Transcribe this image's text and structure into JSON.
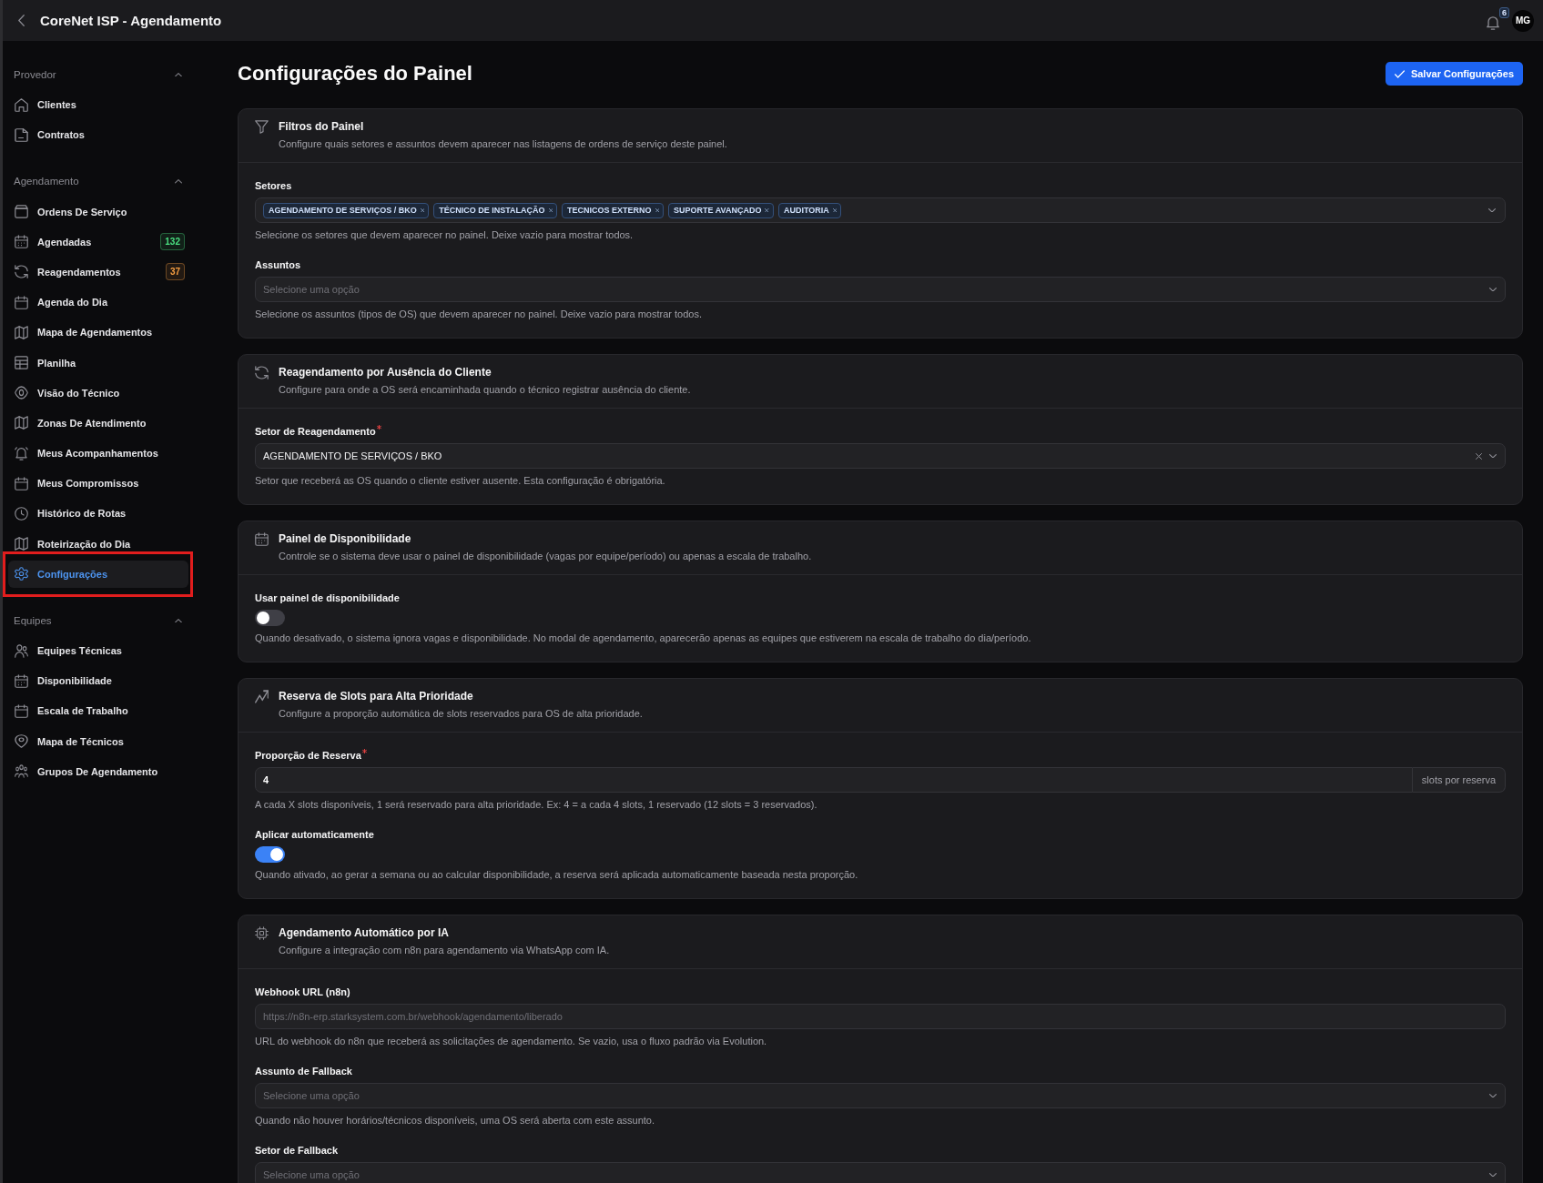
{
  "top_bar": {
    "title": "CoreNet ISP - Agendamento",
    "notification_count": "6",
    "avatar_initials": "MG"
  },
  "sidebar": {
    "groups": [
      {
        "label": "Provedor",
        "expanded": true,
        "items": [
          {
            "label": "Clientes",
            "selected": false,
            "highlighted": false
          },
          {
            "label": "Contratos",
            "selected": false,
            "highlighted": false
          }
        ]
      },
      {
        "label": "Agendamento",
        "expanded": true,
        "items": [
          {
            "label": "Ordens De Serviço",
            "selected": false,
            "highlighted": false
          },
          {
            "label": "Agendadas",
            "selected": false,
            "highlighted": false,
            "badge": {
              "text": "132",
              "color": "#4ade80"
            }
          },
          {
            "label": "Reagendamentos",
            "selected": false,
            "highlighted": false,
            "badge": {
              "text": "37",
              "color": "#f59e42"
            }
          },
          {
            "label": "Agenda do Dia",
            "selected": false,
            "highlighted": false
          },
          {
            "label": "Mapa de Agendamentos",
            "selected": false,
            "highlighted": false
          },
          {
            "label": "Planilha",
            "selected": false,
            "highlighted": false
          },
          {
            "label": "Visão do Técnico",
            "selected": false,
            "highlighted": false
          },
          {
            "label": "Zonas De Atendimento",
            "selected": false,
            "highlighted": false
          },
          {
            "label": "Meus Acompanhamentos",
            "selected": false,
            "highlighted": false
          },
          {
            "label": "Meus Compromissos",
            "selected": false,
            "highlighted": false
          },
          {
            "label": "Histórico de Rotas",
            "selected": false,
            "highlighted": false
          },
          {
            "label": "Roteirização do Dia",
            "selected": false,
            "highlighted": false
          },
          {
            "label": "Configurações",
            "selected": true,
            "highlighted": true
          }
        ]
      },
      {
        "label": "Equipes",
        "expanded": true,
        "items": [
          {
            "label": "Equipes Técnicas",
            "selected": false,
            "highlighted": false
          },
          {
            "label": "Disponibilidade",
            "selected": false,
            "highlighted": false
          },
          {
            "label": "Escala de Trabalho",
            "selected": false,
            "highlighted": false
          },
          {
            "label": "Mapa de Técnicos",
            "selected": false,
            "highlighted": false
          },
          {
            "label": "Grupos De Agendamento",
            "selected": false,
            "highlighted": false
          }
        ]
      }
    ]
  },
  "page": {
    "title": "Configurações do Painel",
    "save_button": "Salvar Configurações"
  },
  "sections": [
    {
      "title": "Filtros do Painel",
      "description": "Configure quais setores e assuntos devem aparecer nas listagens de ordens de serviço deste painel.",
      "fields": [
        {
          "kind": "multiselect",
          "label": "Setores",
          "required": false,
          "tags": [
            "AGENDAMENTO DE SERVIÇOS / BKO",
            "TÉCNICO DE INSTALAÇÃO",
            "TECNICOS EXTERNO",
            "SUPORTE AVANÇADO",
            "AUDITORIA"
          ],
          "help": "Selecione os setores que devem aparecer no painel. Deixe vazio para mostrar todos."
        },
        {
          "kind": "select",
          "label": "Assuntos",
          "required": false,
          "placeholder": "Selecione uma opção",
          "clearable": false,
          "help": "Selecione os assuntos (tipos de OS) que devem aparecer no painel. Deixe vazio para mostrar todos."
        }
      ]
    },
    {
      "title": "Reagendamento por Ausência do Cliente",
      "description": "Configure para onde a OS será encaminhada quando o técnico registrar ausência do cliente.",
      "fields": [
        {
          "kind": "select",
          "label": "Setor de Reagendamento",
          "required": true,
          "value": "AGENDAMENTO DE SERVIÇOS / BKO",
          "clearable": true,
          "help": "Setor que receberá as OS quando o cliente estiver ausente. Esta configuração é obrigatória."
        }
      ]
    },
    {
      "title": "Painel de Disponibilidade",
      "description": "Controle se o sistema deve usar o painel de disponibilidade (vagas por equipe/período) ou apenas a escala de trabalho.",
      "fields": [
        {
          "kind": "toggle",
          "label": "Usar painel de disponibilidade",
          "required": false,
          "on": false,
          "help": "Quando desativado, o sistema ignora vagas e disponibilidade. No modal de agendamento, aparecerão apenas as equipes que estiverem na escala de trabalho do dia/período."
        }
      ]
    },
    {
      "title": "Reserva de Slots para Alta Prioridade",
      "description": "Configure a proporção automática de slots reservados para OS de alta prioridade.",
      "fields": [
        {
          "kind": "number",
          "label": "Proporção de Reserva",
          "required": true,
          "value": "4",
          "suffix": "slots por reserva",
          "help": "A cada X slots disponíveis, 1 será reservado para alta prioridade. Ex: 4 = a cada 4 slots, 1 reservado (12 slots = 3 reservados)."
        },
        {
          "kind": "toggle",
          "label": "Aplicar automaticamente",
          "required": false,
          "on": true,
          "help": "Quando ativado, ao gerar a semana ou ao calcular disponibilidade, a reserva será aplicada automaticamente baseada nesta proporção."
        }
      ]
    },
    {
      "title": "Agendamento Automático por IA",
      "description": "Configure a integração com n8n para agendamento via WhatsApp com IA.",
      "fields": [
        {
          "kind": "text",
          "label": "Webhook URL (n8n)",
          "required": false,
          "placeholder": "https://n8n-erp.starksystem.com.br/webhook/agendamento/liberado",
          "help": "URL do webhook do n8n que receberá as solicitações de agendamento. Se vazio, usa o fluxo padrão via Evolution."
        },
        {
          "kind": "select",
          "label": "Assunto de Fallback",
          "required": false,
          "placeholder": "Selecione uma opção",
          "clearable": false,
          "help": "Quando não houver horários/técnicos disponíveis, uma OS será aberta com este assunto."
        },
        {
          "kind": "select",
          "label": "Setor de Fallback",
          "required": false,
          "placeholder": "Selecione uma opção",
          "clearable": false
        }
      ]
    }
  ]
}
